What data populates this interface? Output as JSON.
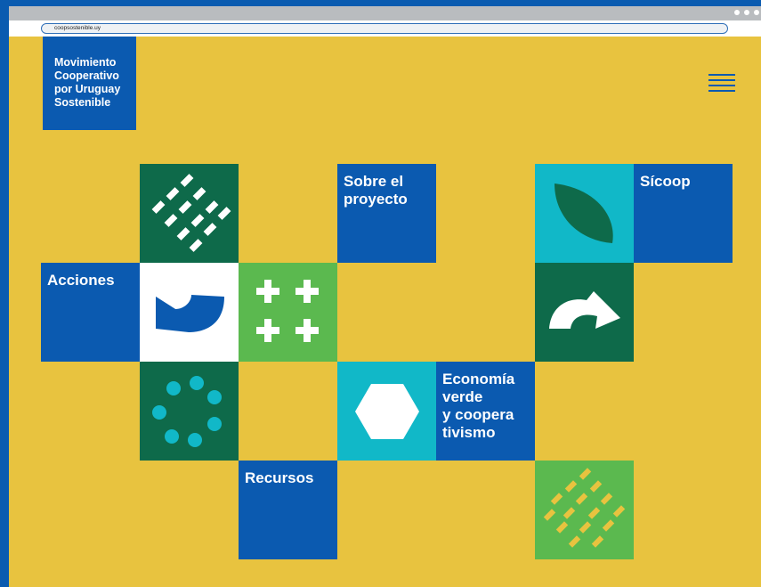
{
  "browser": {
    "url": "coopsostenible.uy"
  },
  "header": {
    "logo_lines": [
      "Movimiento",
      "Cooperativo",
      "por Uruguay",
      "Sostenible"
    ]
  },
  "nav": {
    "sobre_lines": [
      "Sobre el",
      "proyecto"
    ],
    "sicoop_lines": [
      "Sícoop"
    ],
    "acciones_lines": [
      "Acciones"
    ],
    "economia_lines": [
      "Economía",
      "verde",
      "y coopera",
      "tivismo"
    ],
    "recursos_lines": [
      "Recursos"
    ]
  },
  "colors": {
    "background": "#e8c33f",
    "blue": "#0b5ab0",
    "dark_green": "#0e6a4a",
    "light_green": "#5bb94f",
    "cyan": "#11b8c8"
  },
  "icons": [
    "diagonal-dashes-icon",
    "leaf-icon",
    "curved-arrow-icon",
    "plus-grid-icon",
    "return-arrow-icon",
    "dot-circle-icon",
    "hexagon-icon",
    "yellow-dashes-icon"
  ]
}
